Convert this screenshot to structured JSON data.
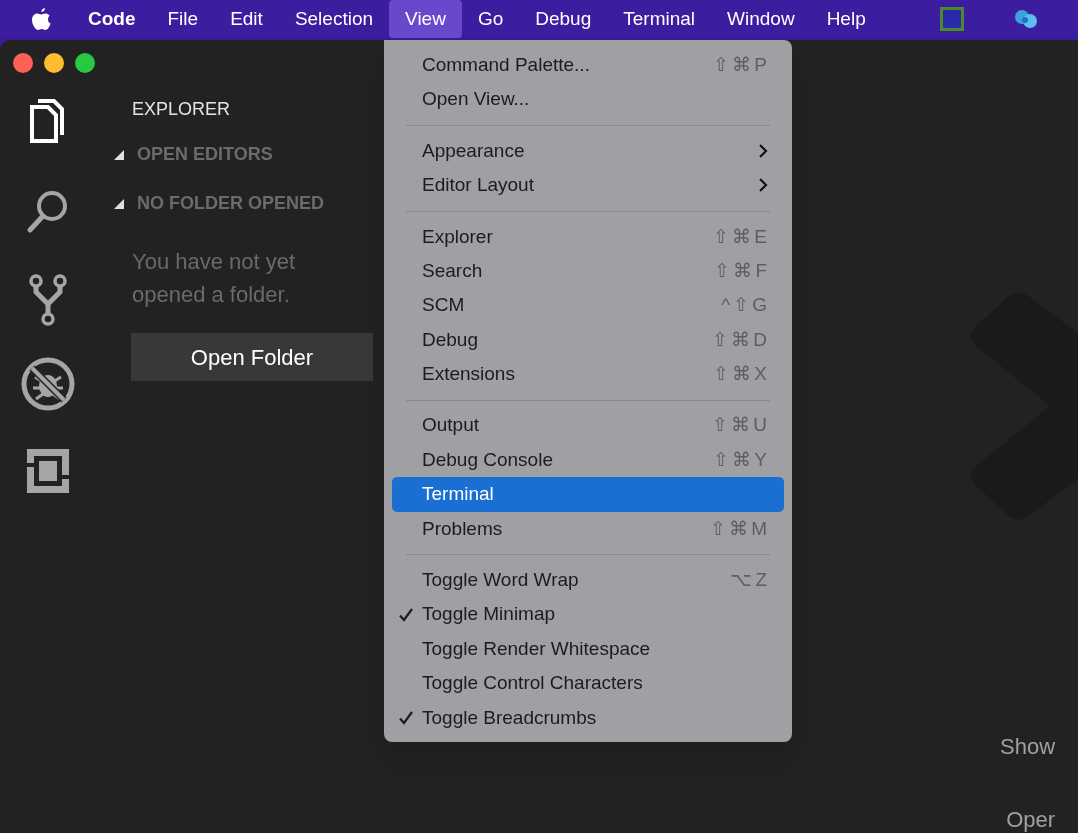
{
  "menu_bar": {
    "items": [
      {
        "label": "Code",
        "selected": false,
        "bold": true
      },
      {
        "label": "File",
        "selected": false,
        "bold": false
      },
      {
        "label": "Edit",
        "selected": false,
        "bold": false
      },
      {
        "label": "Selection",
        "selected": false,
        "bold": false
      },
      {
        "label": "View",
        "selected": true,
        "bold": false
      },
      {
        "label": "Go",
        "selected": false,
        "bold": false
      },
      {
        "label": "Debug",
        "selected": false,
        "bold": false
      },
      {
        "label": "Terminal",
        "selected": false,
        "bold": false
      },
      {
        "label": "Window",
        "selected": false,
        "bold": false
      },
      {
        "label": "Help",
        "selected": false,
        "bold": false
      }
    ]
  },
  "sidebar": {
    "title": "EXPLORER",
    "sections": [
      {
        "label": "OPEN EDITORS",
        "expanded": true
      },
      {
        "label": "NO FOLDER OPENED",
        "expanded": true
      }
    ],
    "message": "You have not yet opened a folder.",
    "button": "Open Folder"
  },
  "editor": {
    "hints": [
      "Show",
      "Oper"
    ]
  },
  "view_menu": {
    "items": [
      {
        "kind": "item",
        "label": "Command Palette...",
        "shortcut": "⇧⌘P",
        "selected": false,
        "checked": false
      },
      {
        "kind": "item",
        "label": "Open View...",
        "selected": false,
        "checked": false
      },
      {
        "kind": "separator"
      },
      {
        "kind": "submenu",
        "label": "Appearance",
        "selected": false,
        "checked": false
      },
      {
        "kind": "submenu",
        "label": "Editor Layout",
        "selected": false,
        "checked": false
      },
      {
        "kind": "separator"
      },
      {
        "kind": "item",
        "label": "Explorer",
        "shortcut": "⇧⌘E",
        "selected": false,
        "checked": false
      },
      {
        "kind": "item",
        "label": "Search",
        "shortcut": "⇧⌘F",
        "selected": false,
        "checked": false
      },
      {
        "kind": "item",
        "label": "SCM",
        "shortcut": "^⇧G",
        "selected": false,
        "checked": false
      },
      {
        "kind": "item",
        "label": "Debug",
        "shortcut": "⇧⌘D",
        "selected": false,
        "checked": false
      },
      {
        "kind": "item",
        "label": "Extensions",
        "shortcut": "⇧⌘X",
        "selected": false,
        "checked": false
      },
      {
        "kind": "separator"
      },
      {
        "kind": "item",
        "label": "Output",
        "shortcut": "⇧⌘U",
        "selected": false,
        "checked": false
      },
      {
        "kind": "item",
        "label": "Debug Console",
        "shortcut": "⇧⌘Y",
        "selected": false,
        "checked": false
      },
      {
        "kind": "item",
        "label": "Terminal",
        "selected": true,
        "checked": false
      },
      {
        "kind": "item",
        "label": "Problems",
        "shortcut": "⇧⌘M",
        "selected": false,
        "checked": false
      },
      {
        "kind": "separator"
      },
      {
        "kind": "item",
        "label": "Toggle Word Wrap",
        "shortcut": "⌥Z",
        "selected": false,
        "checked": false
      },
      {
        "kind": "item",
        "label": "Toggle Minimap",
        "selected": false,
        "checked": true
      },
      {
        "kind": "item",
        "label": "Toggle Render Whitespace",
        "selected": false,
        "checked": false
      },
      {
        "kind": "item",
        "label": "Toggle Control Characters",
        "selected": false,
        "checked": false
      },
      {
        "kind": "item",
        "label": "Toggle Breadcrumbs",
        "selected": false,
        "checked": true
      }
    ]
  }
}
